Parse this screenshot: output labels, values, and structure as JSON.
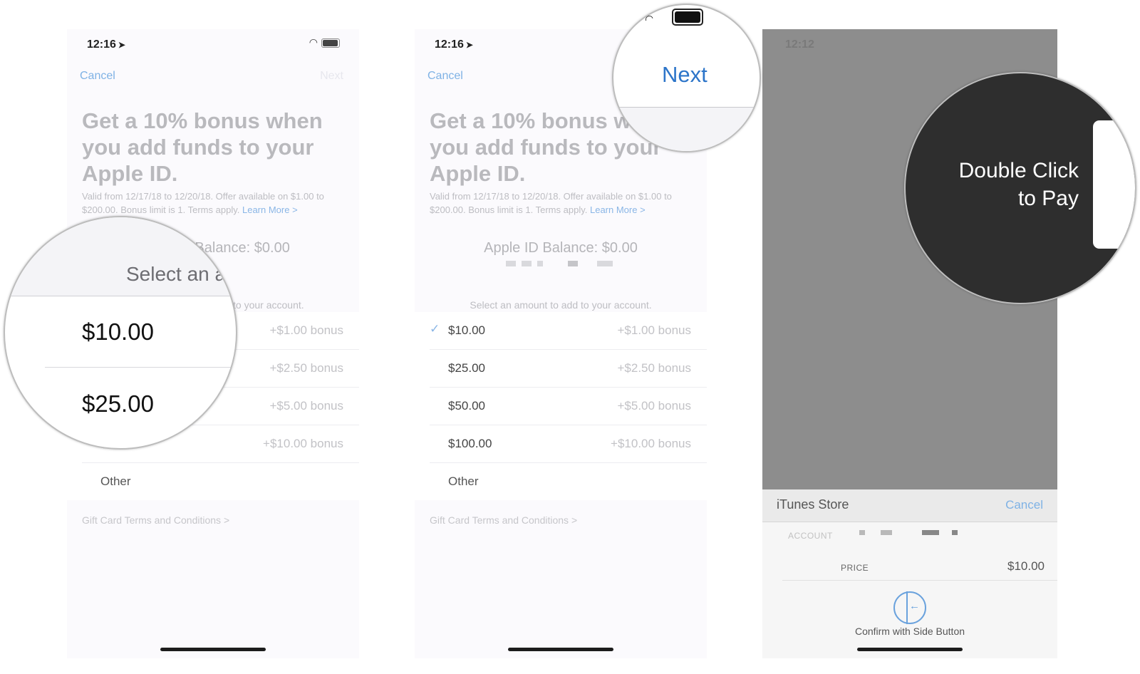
{
  "colors": {
    "accent": "#2d75c9",
    "link": "#8ab6e6",
    "dark_overlay": "#2e2e2e"
  },
  "status": {
    "time": "12:16",
    "time_dim": "12:12"
  },
  "nav": {
    "cancel": "Cancel",
    "next": "Next"
  },
  "offer": {
    "headline": "Get a 10% bonus when you add funds to your Apple ID.",
    "fine_print": "Valid from 12/17/18 to 12/20/18. Offer available on $1.00 to $200.00. Bonus limit is 1. Terms apply.",
    "learn_more": "Learn More >"
  },
  "balance": "Apple ID Balance: $0.00",
  "select_amount": "Select an amount to add to your account.",
  "amounts": [
    {
      "amount": "$10.00",
      "bonus": "+$1.00 bonus"
    },
    {
      "amount": "$25.00",
      "bonus": "+$2.50 bonus"
    },
    {
      "amount": "$50.00",
      "bonus": "+$5.00 bonus"
    },
    {
      "amount": "$100.00",
      "bonus": "+$10.00 bonus"
    }
  ],
  "other": "Other",
  "gift_card_terms": "Gift Card Terms and Conditions >",
  "zoom1": {
    "select": "Select an a",
    "amount1": "$10.00",
    "amount2": "$25.00"
  },
  "zoom2": {
    "next": "Next"
  },
  "zoom3": {
    "line1": "Double Click",
    "line2": "to Pay"
  },
  "sheet": {
    "title": "iTunes Store",
    "cancel": "Cancel",
    "account_label": "ACCOUNT",
    "price_label": "PRICE",
    "price_value": "$10.00",
    "confirm": "Confirm with Side Button",
    "icon": "side-button-icon"
  }
}
